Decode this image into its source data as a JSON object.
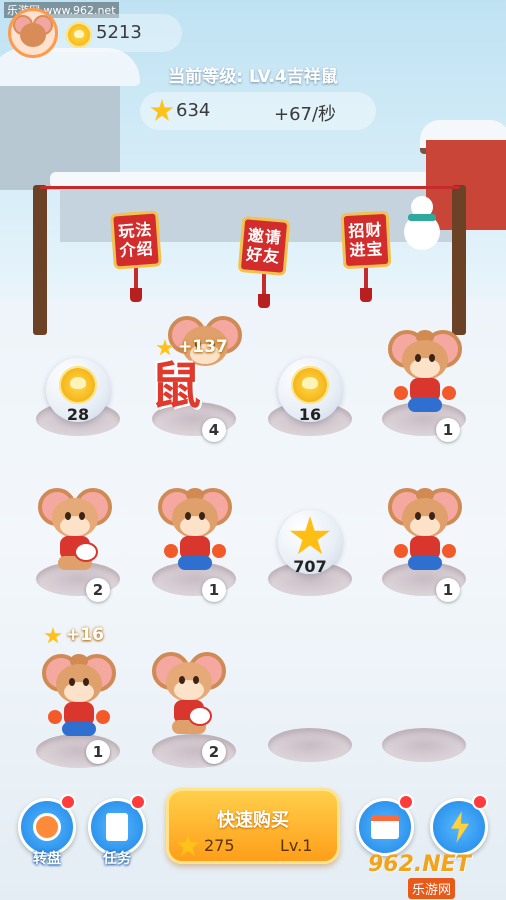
{
  "watermark_top": "乐游网 www.962.net",
  "header": {
    "coins": "5213",
    "level_text": "当前等级: LV.4吉祥鼠",
    "stars": "634",
    "rate": "+67/秒"
  },
  "banners": [
    {
      "label": "玩法介绍"
    },
    {
      "label": "邀请好友"
    },
    {
      "label": "招财进宝"
    }
  ],
  "grid": {
    "r0c0": {
      "type": "coin-bubble",
      "value": "28"
    },
    "r0c1": {
      "type": "mouse-lv4",
      "glyph": "鼠",
      "level": "4",
      "gain": "+137"
    },
    "r0c2": {
      "type": "coin-bubble",
      "value": "16"
    },
    "r0c3": {
      "type": "mouse-lv1",
      "level": "1"
    },
    "r1c0": {
      "type": "mouse-lv2",
      "level": "2"
    },
    "r1c1": {
      "type": "mouse-lv1",
      "level": "1"
    },
    "r1c2": {
      "type": "star-bubble",
      "value": "707"
    },
    "r1c3": {
      "type": "mouse-lv1",
      "level": "1"
    },
    "r2c0": {
      "type": "mouse-lv1",
      "level": "1",
      "gain": "+16"
    },
    "r2c1": {
      "type": "mouse-lv2",
      "level": "2"
    },
    "r2c2": {
      "type": "empty"
    },
    "r2c3": {
      "type": "empty"
    }
  },
  "bottom": {
    "spin_label": "转盘",
    "tasks_label": "任务",
    "buy_title": "快速购买",
    "buy_cost": "275",
    "buy_level": "Lv.1",
    "watermark_main": "962.NET",
    "watermark_sub": "乐游网"
  },
  "colors": {
    "accent": "#ff9e1a",
    "badge_dot": "#ff3b3b",
    "mouse_red": "#d9362e"
  }
}
